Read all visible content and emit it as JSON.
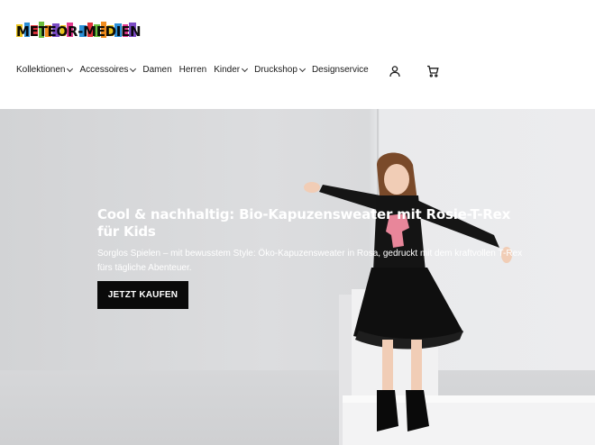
{
  "brand": {
    "logo_text": "METEOR-MEDIEN"
  },
  "nav": {
    "items": [
      {
        "label": "Kollektionen",
        "has_dropdown": true
      },
      {
        "label": "Accessoires",
        "has_dropdown": true
      },
      {
        "label": "Damen",
        "has_dropdown": false
      },
      {
        "label": "Herren",
        "has_dropdown": false
      },
      {
        "label": "Kinder",
        "has_dropdown": true
      },
      {
        "label": "Druckshop",
        "has_dropdown": true
      },
      {
        "label": "Designservice",
        "has_dropdown": false
      }
    ],
    "account_icon": "user-icon",
    "cart_icon": "cart-icon"
  },
  "hero": {
    "title": "Cool & nachhaltig: Bio-Kapuzensweater mit Rosie-T-Rex für Kids",
    "subtitle": "Sorglos Spielen – mit bewusstem Style: Öko-Kapuzensweater in Rosa, gedruckt mit dem kraftvollen T-Rex fürs tägliche Abenteuer.",
    "cta_label": "JETZT KAUFEN"
  },
  "colors": {
    "accent": "#0a0a0a",
    "hero_text": "#ffffff",
    "background": "#ffffff"
  }
}
